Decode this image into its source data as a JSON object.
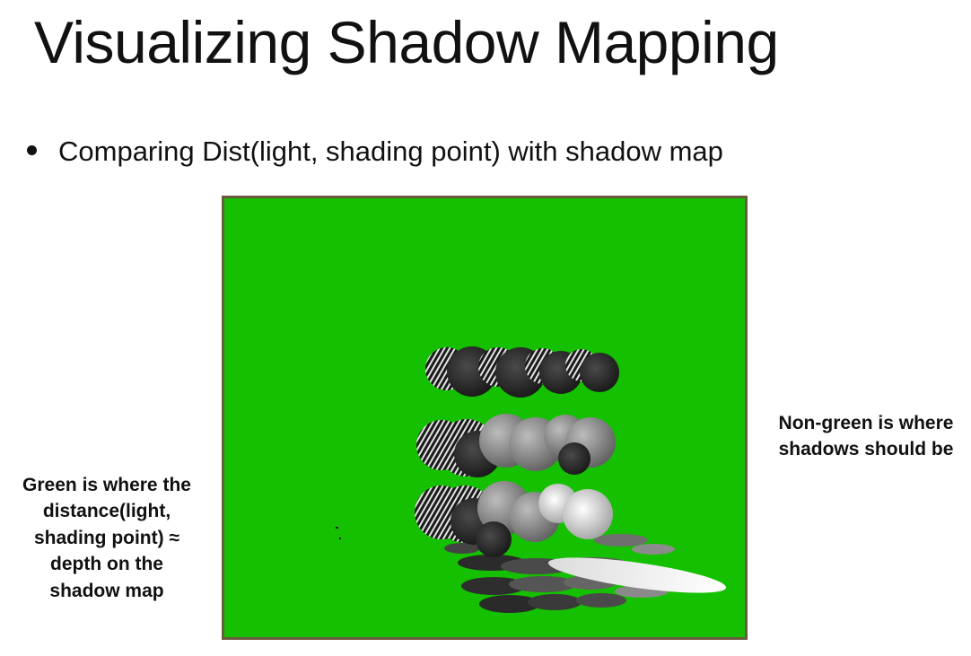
{
  "slide": {
    "title": "Visualizing Shadow Mapping",
    "bullet": "Comparing Dist(light, shading point) with shadow map"
  },
  "annotations": {
    "left": [
      "Green is where the",
      "distance(light,",
      "shading point) ≈",
      "depth on the",
      "shadow map"
    ],
    "right": [
      "Non-green is where",
      "shadows should be"
    ]
  },
  "colors": {
    "match_area": "#14c000",
    "frame_border": "#6a5a3f"
  }
}
